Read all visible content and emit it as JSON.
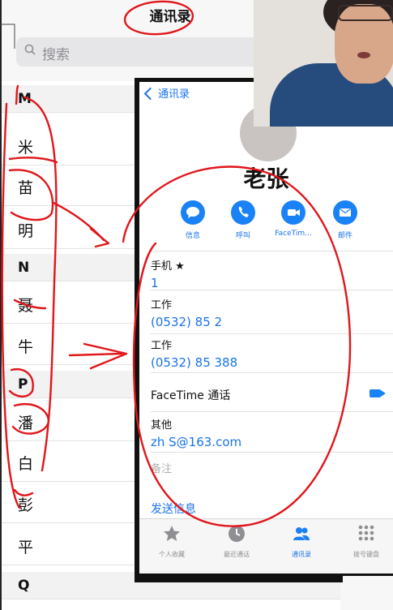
{
  "list": {
    "title": "通讯录",
    "search_placeholder": "搜索",
    "rows": [
      {
        "text": "M",
        "section": true
      },
      {
        "text": "米",
        "section": false
      },
      {
        "text": "苗",
        "section": false
      },
      {
        "text": "明",
        "section": false
      },
      {
        "text": "N",
        "section": true
      },
      {
        "text": "聂",
        "section": false
      },
      {
        "text": "牛",
        "section": false
      },
      {
        "text": "P",
        "section": true
      },
      {
        "text": "潘",
        "section": false
      },
      {
        "text": "白",
        "section": false
      },
      {
        "text": "彭",
        "section": false
      },
      {
        "text": "平",
        "section": false
      },
      {
        "text": "Q",
        "section": true
      }
    ]
  },
  "detail": {
    "back_label": "通讯录",
    "name": "老张",
    "actions": [
      {
        "label": "信息",
        "icon": "message-icon"
      },
      {
        "label": "呼叫",
        "icon": "phone-icon"
      },
      {
        "label": "FaceTim...",
        "icon": "video-icon"
      },
      {
        "label": "邮件",
        "icon": "mail-icon"
      }
    ],
    "fields": [
      {
        "label": "手机 ★",
        "value": "1"
      },
      {
        "label": "工作",
        "value": "(0532) 85   2"
      },
      {
        "label": "工作",
        "value": "(0532) 85    388"
      },
      {
        "label": "其他",
        "value": "zh         S@163.com"
      }
    ],
    "facetime_label": "FaceTime 通话",
    "notes_label": "备注",
    "send_message": "发送信息"
  },
  "tabbar": [
    {
      "label": "个人收藏",
      "icon": "star-icon",
      "active": false
    },
    {
      "label": "最近通话",
      "icon": "clock-icon",
      "active": false
    },
    {
      "label": "通讯录",
      "icon": "contacts-icon",
      "active": true
    },
    {
      "label": "拨号键盘",
      "icon": "keypad-icon",
      "active": false
    }
  ],
  "colors": {
    "accent": "#1a73e8",
    "annotation": "#e0161b"
  }
}
